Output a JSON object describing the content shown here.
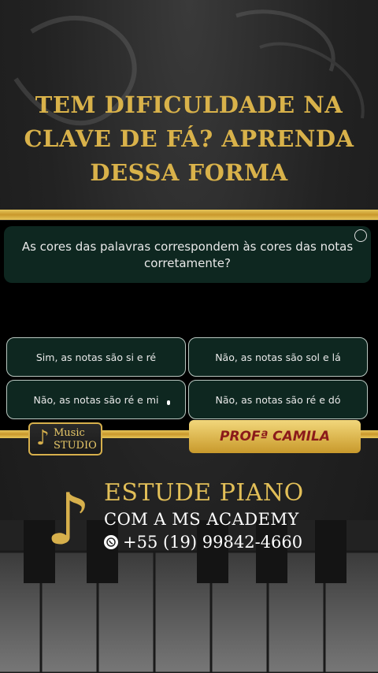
{
  "headline": {
    "line1": "TEM DIFICULDADE NA",
    "line2": "CLAVE DE FÁ? APRENDA",
    "line3": "DESSA FORMA"
  },
  "quiz": {
    "question_line1": "As cores das palavras correspondem às cores das notas",
    "question_line2": "corretamente?",
    "options": [
      "Sim, as notas são si e ré",
      "Não, as notas são sol e lá",
      "Não, as notas são ré e mi",
      "Não, as notas são ré e dó"
    ]
  },
  "logo": {
    "icon": "music-note-icon",
    "line1": "Music",
    "line2": "STUDIO"
  },
  "badge": {
    "label": "PROFª CAMILA"
  },
  "cta": {
    "line1": "ESTUDE PIANO",
    "line2": "COM A MS ACADEMY",
    "phone": "+55 (19) 99842-4660",
    "phone_icon": "whatsapp-icon"
  },
  "colors": {
    "gold": "#d9b24a",
    "dark_green": "#0e2720",
    "badge_text": "#8b1a1a"
  }
}
